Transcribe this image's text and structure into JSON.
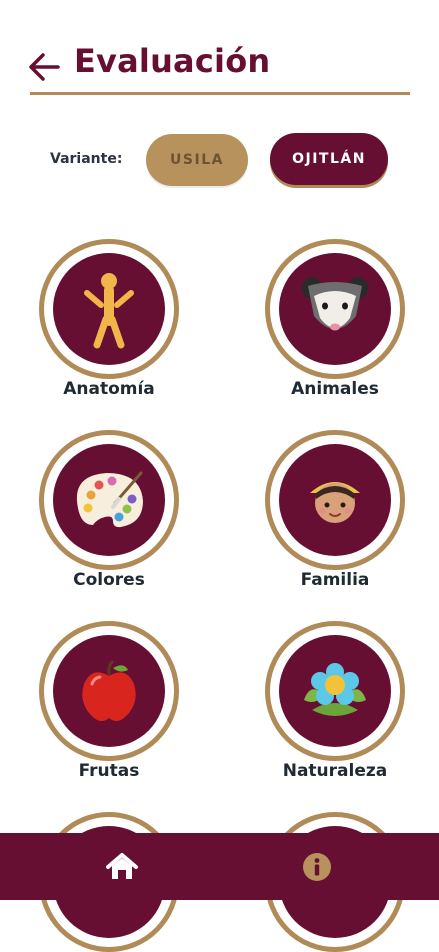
{
  "header": {
    "title": "Evaluación"
  },
  "variant": {
    "label": "Variante:",
    "options": [
      {
        "label": "USILA",
        "selected": false
      },
      {
        "label": "OJITLÁN",
        "selected": true
      }
    ]
  },
  "categories": [
    {
      "label": "Anatomía",
      "icon": "human-figure-icon"
    },
    {
      "label": "Animales",
      "icon": "opossum-icon"
    },
    {
      "label": "Colores",
      "icon": "palette-icon"
    },
    {
      "label": "Familia",
      "icon": "child-face-icon"
    },
    {
      "label": "Frutas",
      "icon": "apple-icon"
    },
    {
      "label": "Naturaleza",
      "icon": "flower-icon"
    }
  ],
  "bottom_nav": [
    {
      "icon": "home-icon"
    },
    {
      "icon": "info-icon"
    }
  ],
  "colors": {
    "primary": "#660F33",
    "accent": "#B08A57",
    "text": "#1F2A33"
  }
}
